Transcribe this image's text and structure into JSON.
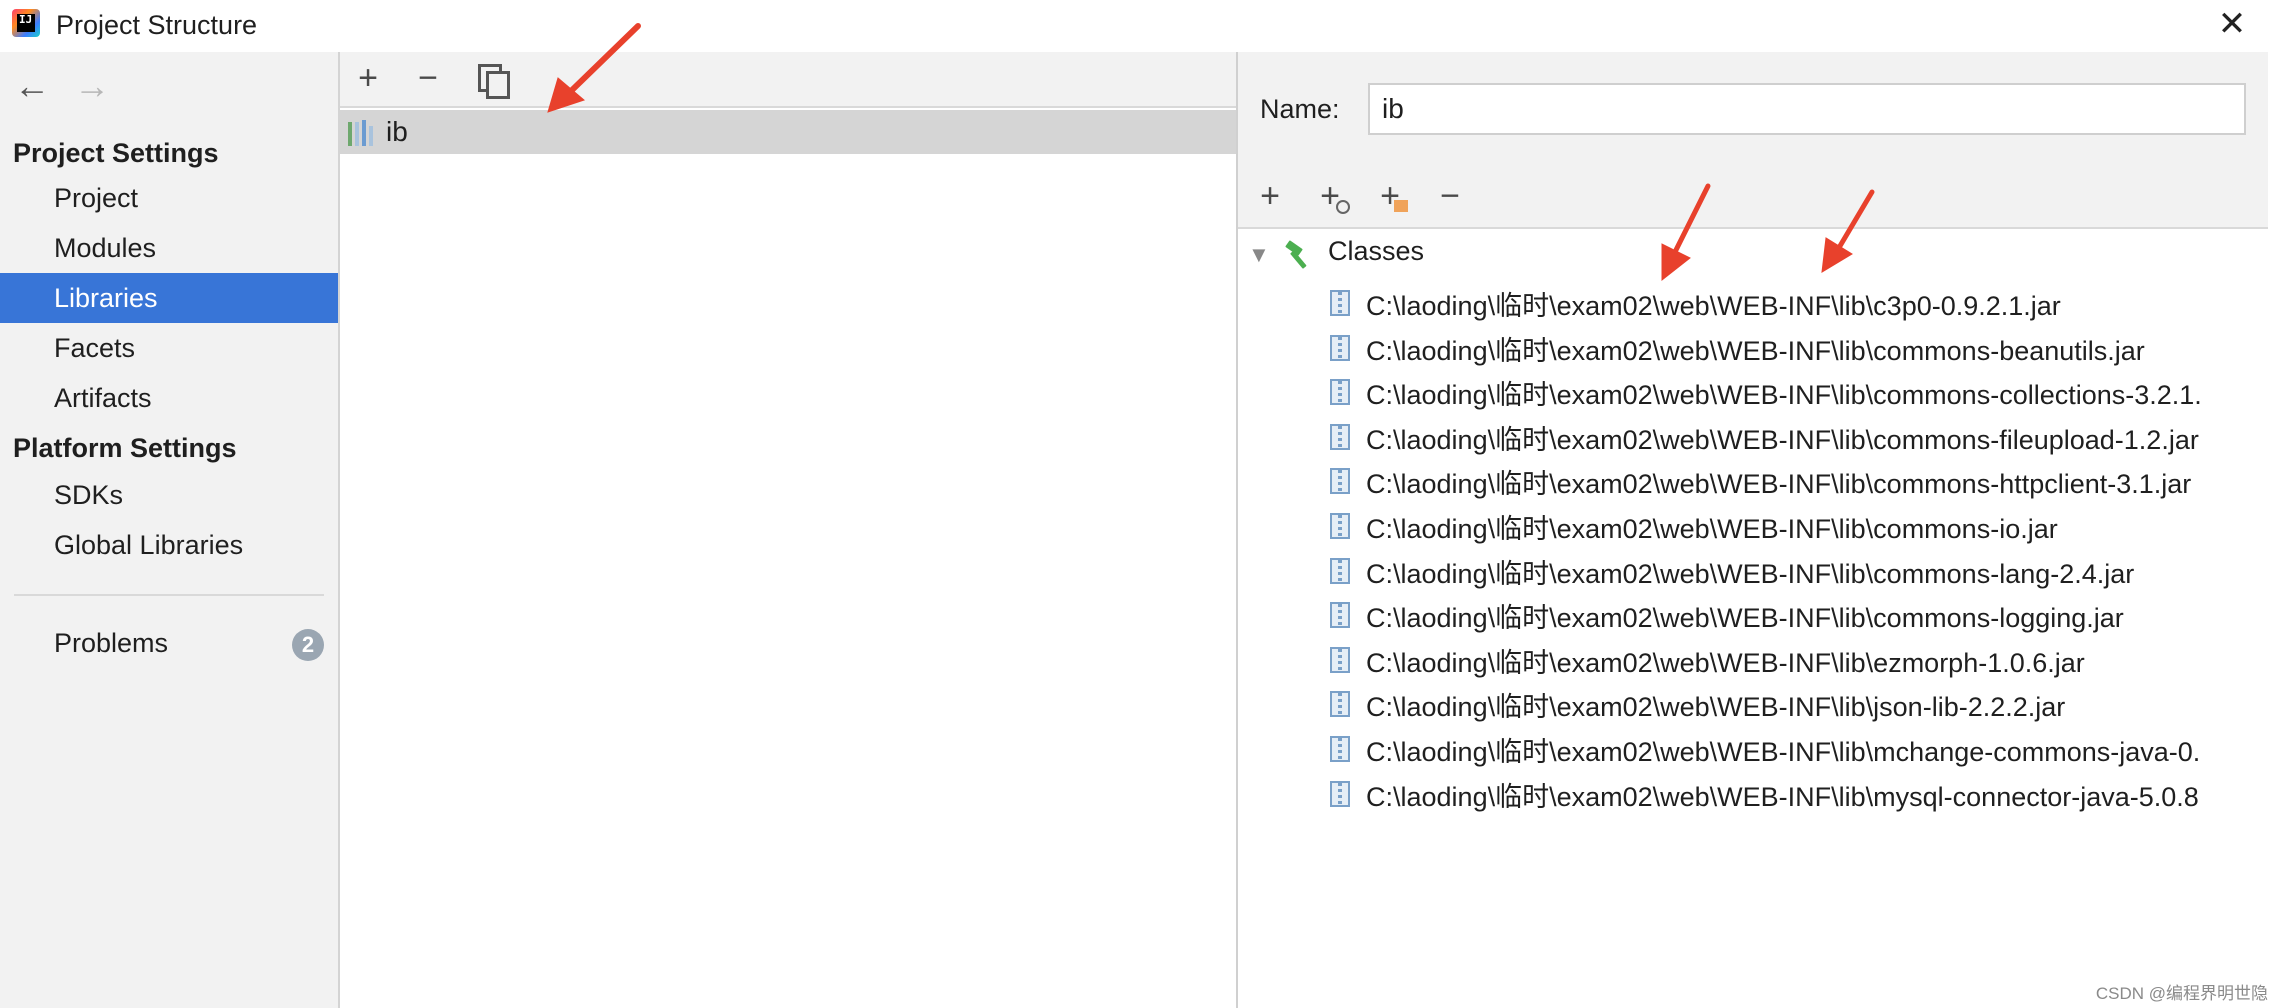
{
  "window": {
    "title": "Project Structure",
    "close_glyph": "✕"
  },
  "nav": {
    "back": "←",
    "forward": "→"
  },
  "sidebar": {
    "project_settings_header": "Project Settings",
    "project_items": [
      "Project",
      "Modules",
      "Libraries",
      "Facets",
      "Artifacts"
    ],
    "platform_settings_header": "Platform Settings",
    "platform_items": [
      "SDKs",
      "Global Libraries"
    ],
    "problems_label": "Problems",
    "problems_count": "2",
    "selected": "Libraries",
    "selected_color": "#3875d7"
  },
  "middle": {
    "toolbar": {
      "add": "+",
      "remove": "−"
    },
    "libraries": [
      {
        "name": "ib"
      }
    ]
  },
  "right": {
    "name_label": "Name:",
    "name_value": "ib",
    "toolbar": {
      "add": "+",
      "add_with_badge_1": "+",
      "add_with_badge_2": "+",
      "remove": "−"
    },
    "tree": {
      "root_label": "Classes",
      "entries": [
        "C:\\laoding\\临时\\exam02\\web\\WEB-INF\\lib\\c3p0-0.9.2.1.jar",
        "C:\\laoding\\临时\\exam02\\web\\WEB-INF\\lib\\commons-beanutils.jar",
        "C:\\laoding\\临时\\exam02\\web\\WEB-INF\\lib\\commons-collections-3.2.1.",
        "C:\\laoding\\临时\\exam02\\web\\WEB-INF\\lib\\commons-fileupload-1.2.jar",
        "C:\\laoding\\临时\\exam02\\web\\WEB-INF\\lib\\commons-httpclient-3.1.jar",
        "C:\\laoding\\临时\\exam02\\web\\WEB-INF\\lib\\commons-io.jar",
        "C:\\laoding\\临时\\exam02\\web\\WEB-INF\\lib\\commons-lang-2.4.jar",
        "C:\\laoding\\临时\\exam02\\web\\WEB-INF\\lib\\commons-logging.jar",
        "C:\\laoding\\临时\\exam02\\web\\WEB-INF\\lib\\ezmorph-1.0.6.jar",
        "C:\\laoding\\临时\\exam02\\web\\WEB-INF\\lib\\json-lib-2.2.2.jar",
        "C:\\laoding\\临时\\exam02\\web\\WEB-INF\\lib\\mchange-commons-java-0.",
        "C:\\laoding\\临时\\exam02\\web\\WEB-INF\\lib\\mysql-connector-java-5.0.8"
      ]
    }
  },
  "annotation_arrow_color": "#e8412c",
  "watermark": "CSDN @编程界明世隐"
}
